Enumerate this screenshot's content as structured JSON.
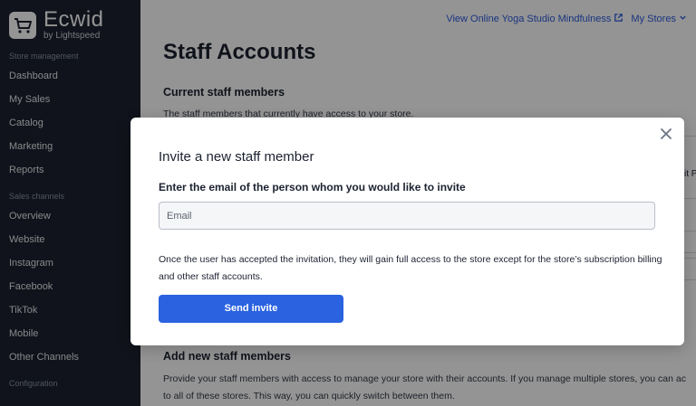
{
  "sidebar": {
    "brand": "Ecwid",
    "brand_sub": "by Lightspeed",
    "sections": [
      {
        "title": "Store management",
        "items": [
          "Dashboard",
          "My Sales",
          "Catalog",
          "Marketing",
          "Reports"
        ]
      },
      {
        "title": "Sales channels",
        "items": [
          "Overview",
          "Website",
          "Instagram",
          "Facebook",
          "TikTok",
          "Mobile",
          "Other Channels"
        ]
      },
      {
        "title": "Configuration",
        "items": []
      }
    ]
  },
  "topbar": {
    "store_link": "View Online Yoga Studio Mindfulness",
    "my_stores": "My Stores"
  },
  "page": {
    "title": "Staff Accounts",
    "current_title": "Current staff members",
    "current_desc": "The staff members that currently have access to your store.",
    "bg_fragment": "it P",
    "add_title": "Add new staff members",
    "add_desc_line1": "Provide your staff members with access to manage your store with their accounts. If you manage multiple stores, you can ac",
    "add_desc_line2": "to all of these stores. This way, you can quickly switch between them."
  },
  "modal": {
    "title": "Invite a new staff member",
    "field_label": "Enter the email of the person whom you would like to invite",
    "email_placeholder": "Email",
    "email_value": "",
    "info": "Once the user has accepted the invitation, they will gain full access to the store except for the store’s subscription billing and other staff accounts.",
    "send_label": "Send invite"
  },
  "colors": {
    "sidebar_bg": "#1c2230",
    "accent": "#2a62e0",
    "link": "#2b5bdc"
  },
  "icons": [
    "basket-logo-icon",
    "external-link-icon",
    "chevron-down-icon",
    "close-icon"
  ]
}
